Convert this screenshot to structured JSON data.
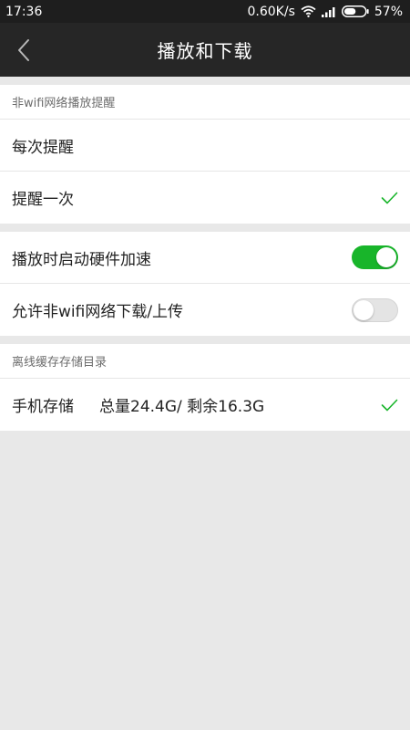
{
  "status_bar": {
    "time": "17:36",
    "net_speed": "0.60K/s",
    "battery": "57%",
    "battery_level": 0.57
  },
  "header": {
    "title": "播放和下载",
    "back_icon": "chevron-left-icon"
  },
  "sections": {
    "non_wifi_reminder": {
      "header": "非wifi网络播放提醒",
      "options": [
        {
          "label": "每次提醒",
          "selected": false
        },
        {
          "label": "提醒一次",
          "selected": true
        }
      ]
    },
    "toggles": [
      {
        "label": "播放时启动硬件加速",
        "on": true
      },
      {
        "label": "允许非wifi网络下载/上传",
        "on": false
      }
    ],
    "offline_cache": {
      "header": "离线缓存存储目录",
      "item_label": "手机存储",
      "storage_info": "总量24.4G/ 剩余16.3G",
      "selected": true
    }
  },
  "colors": {
    "accent": "#18b52a",
    "titlebar": "#262626",
    "statusbar": "#1e1e1e",
    "background": "#e8e8e8"
  }
}
